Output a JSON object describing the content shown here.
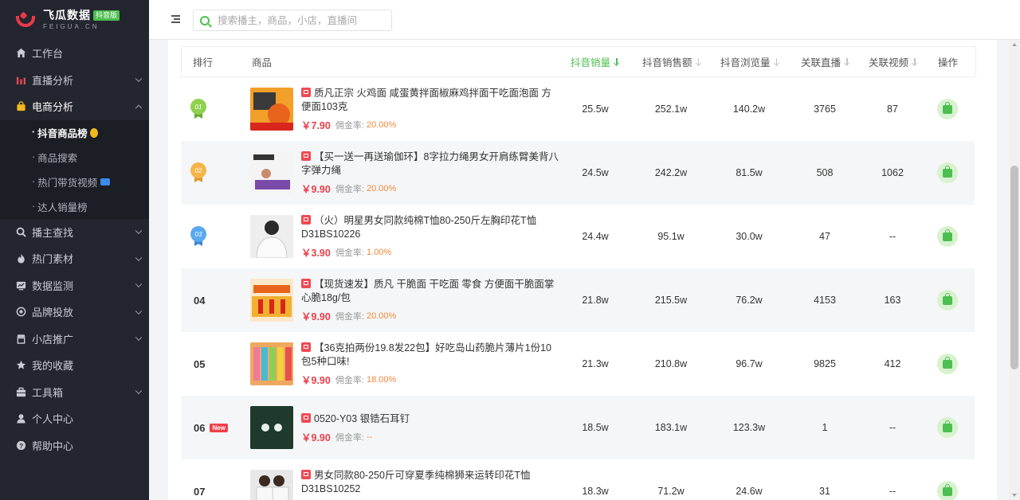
{
  "brand": {
    "name": "飞瓜数据",
    "badge": "抖音版",
    "sub": "FEIGUA.CN"
  },
  "sidebar": {
    "items": [
      {
        "label": "工作台",
        "icon": "home-icon",
        "expandable": false
      },
      {
        "label": "直播分析",
        "icon": "bar-chart-icon",
        "expandable": true
      },
      {
        "label": "电商分析",
        "icon": "shopping-bag-icon",
        "expandable": true,
        "open": true
      },
      {
        "label": "播主查找",
        "icon": "search-icon",
        "expandable": true
      },
      {
        "label": "热门素材",
        "icon": "flame-icon",
        "expandable": true
      },
      {
        "label": "数据监测",
        "icon": "monitor-icon",
        "expandable": true
      },
      {
        "label": "品牌投放",
        "icon": "target-icon",
        "expandable": true
      },
      {
        "label": "小店推广",
        "icon": "store-icon",
        "expandable": true
      },
      {
        "label": "我的收藏",
        "icon": "star-icon",
        "expandable": false
      },
      {
        "label": "工具箱",
        "icon": "toolbox-icon",
        "expandable": true
      },
      {
        "label": "个人中心",
        "icon": "user-icon",
        "expandable": false
      },
      {
        "label": "帮助中心",
        "icon": "help-icon",
        "expandable": false
      }
    ],
    "subitems": [
      {
        "label": "抖音商品榜",
        "active": true
      },
      {
        "label": "商品搜索"
      },
      {
        "label": "热门带货视频"
      },
      {
        "label": "达人销量榜"
      }
    ]
  },
  "search": {
    "placeholder": "搜索播主，商品，小店，直播间"
  },
  "table": {
    "headers": {
      "rank": "排行",
      "product": "商品",
      "sales": "抖音销量",
      "revenue": "抖音销售额",
      "views": "抖音浏览量",
      "live": "关联直播",
      "video": "关联视频",
      "op": "操作"
    },
    "commission_label": "佣金率:",
    "rows": [
      {
        "rank": "01",
        "title": "质凡正宗 火鸡面 咸蛋黄拌面椒麻鸡拌面干吃面泡面 方便面103克",
        "price": "￥7.90",
        "rate": "20.00%",
        "sales": "25.5w",
        "revenue": "252.1w",
        "views": "140.2w",
        "live": "3765",
        "video": "87"
      },
      {
        "rank": "02",
        "title": "【买一送一再送瑜伽环】8字拉力绳男女开肩练臂美背八字弹力绳",
        "price": "￥9.90",
        "rate": "20.00%",
        "sales": "24.5w",
        "revenue": "242.2w",
        "views": "81.5w",
        "live": "508",
        "video": "1062"
      },
      {
        "rank": "03",
        "title": "（火）明星男女同款纯棉T恤80-250斤左胸印花T恤D31BS10226",
        "price": "￥3.90",
        "rate": "1.00%",
        "sales": "24.4w",
        "revenue": "95.1w",
        "views": "30.0w",
        "live": "47",
        "video": "--"
      },
      {
        "rank": "04",
        "title": "【现货速发】质凡 干脆面 干吃面 零食 方便面干脆面掌心脆18g/包",
        "price": "￥9.90",
        "rate": "20.00%",
        "sales": "21.8w",
        "revenue": "215.5w",
        "views": "76.2w",
        "live": "4153",
        "video": "163"
      },
      {
        "rank": "05",
        "title": "【36克拍两份19.8发22包】好吃岛山药脆片薄片1份10包5种口味!",
        "price": "￥9.90",
        "rate": "18.00%",
        "sales": "21.3w",
        "revenue": "210.8w",
        "views": "96.7w",
        "live": "9825",
        "video": "412"
      },
      {
        "rank": "06",
        "badge": "New",
        "title": "0520-Y03 银锆石耳钉",
        "price": "￥9.90",
        "rate": "--",
        "sales": "18.5w",
        "revenue": "183.1w",
        "views": "123.3w",
        "live": "1",
        "video": "--"
      },
      {
        "rank": "07",
        "title": "男女同款80-250斤可穿夏季纯棉狮来运转印花T恤D31BS10252",
        "price": "",
        "rate": "",
        "sales": "18.3w",
        "revenue": "71.2w",
        "views": "24.6w",
        "live": "31",
        "video": "--"
      }
    ]
  },
  "colors": {
    "accent": "#4cbf50",
    "price": "#e8404c",
    "rate": "#f0883a",
    "sidebar": "#24262f",
    "gold": "#8fd14f",
    "silver": "#f5b54a",
    "bronze": "#5aa9f0"
  }
}
